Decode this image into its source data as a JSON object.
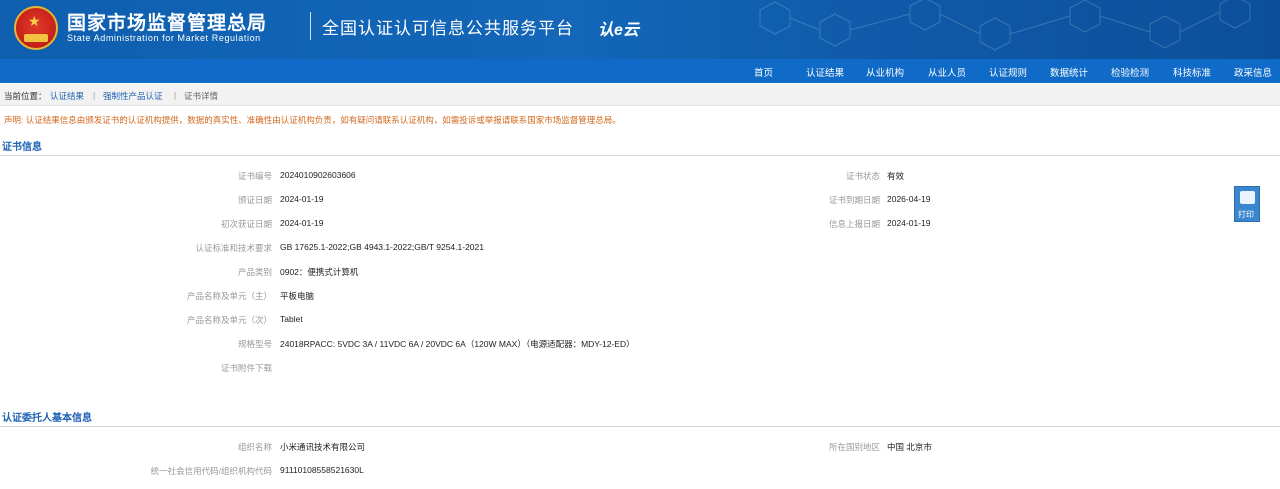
{
  "header": {
    "agency_cn": "国家市场监督管理总局",
    "agency_en": "State Administration  for  Market Regulation",
    "platform_title": "全国认证认可信息公共服务平台",
    "platform_logo": "认e云",
    "colors": {
      "header_bg": "#1366b8",
      "nav_bg": "#0f6bc7"
    }
  },
  "nav": {
    "items": [
      "首页",
      "认证结果",
      "从业机构",
      "从业人员",
      "认证规则",
      "数据统计",
      "检验检测",
      "科技标准",
      "政采信息"
    ]
  },
  "breadcrumb": {
    "prefix": "当前位置：",
    "items": [
      "认证结果",
      "强制性产品认证",
      "证书详情"
    ],
    "separator": "|"
  },
  "notice": "声明: 认证结果信息由颁发证书的认证机构提供，数据的真实性、准确性由认证机构负责，如有疑问请联系认证机构，如需投诉或举报请联系国家市场监督管理总局。",
  "certificate": {
    "section_title": "证书信息",
    "left": [
      {
        "label": "证书编号",
        "value": "2024010902603606"
      },
      {
        "label": "颁证日期",
        "value": "2024-01-19"
      },
      {
        "label": "初次获证日期",
        "value": "2024-01-19"
      },
      {
        "label": "认证标准和技术要求",
        "value": "GB 17625.1-2022;GB 4943.1-2022;GB/T 9254.1-2021"
      },
      {
        "label": "产品类别",
        "value": "0902：便携式计算机"
      },
      {
        "label": "产品名称及单元（主）",
        "value": "平板电脑"
      },
      {
        "label": "产品名称及单元（次）",
        "value": "Tablet"
      },
      {
        "label": "规格型号",
        "value": "24018RPACC: 5VDC 3A / 11VDC 6A / 20VDC 6A（120W MAX）（电源适配器：MDY-12-ED）"
      },
      {
        "label": "证书附件下载",
        "value": ""
      }
    ],
    "right": [
      {
        "label": "证书状态",
        "value": "有效"
      },
      {
        "label": "证书到期日期",
        "value": "2026-04-19"
      },
      {
        "label": "信息上报日期",
        "value": "2024-01-19"
      }
    ],
    "print_label": "打印"
  },
  "client": {
    "section_title": "认证委托人基本信息",
    "left": [
      {
        "label": "组织名称",
        "value": "小米通讯技术有限公司"
      },
      {
        "label": "统一社会信用代码/组织机构代码",
        "value": "91110108558521630L"
      }
    ],
    "right": [
      {
        "label": "所在国别地区",
        "value": "中国 北京市"
      }
    ]
  }
}
